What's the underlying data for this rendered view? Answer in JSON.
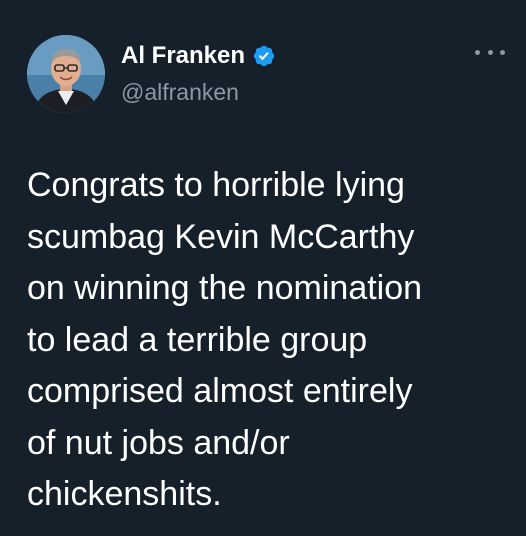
{
  "tweet": {
    "author": {
      "display_name": "Al Franken",
      "handle": "@alfranken",
      "verified": true
    },
    "text_lines": [
      "Congrats to horrible lying",
      "scumbag Kevin McCarthy",
      "on winning the nomination",
      "to lead a terrible group",
      "comprised almost entirely",
      "of nut jobs and/or",
      "chickenshits."
    ]
  },
  "colors": {
    "background": "#15202b",
    "primary_text": "#ffffff",
    "secondary_text": "#8b98a5",
    "verified_badge": "#1d9bf0"
  },
  "icons": {
    "verified": "verified-badge-icon",
    "more": "more-options-icon"
  }
}
